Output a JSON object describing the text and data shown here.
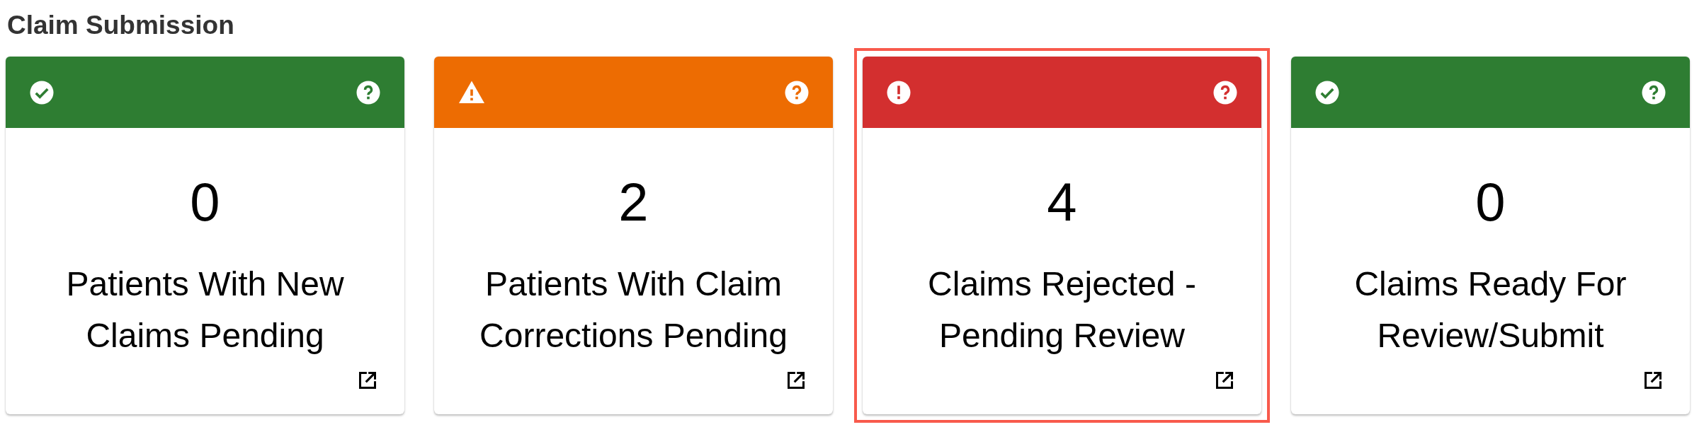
{
  "title": "Claim Submission",
  "cards": [
    {
      "kind": "success",
      "count": "0",
      "label": "Patients With New Claims Pending",
      "selected": false
    },
    {
      "kind": "warning",
      "count": "2",
      "label": "Patients With Claim Corrections Pending",
      "selected": false
    },
    {
      "kind": "error",
      "count": "4",
      "label": "Claims Rejected - Pending Review",
      "selected": true
    },
    {
      "kind": "success",
      "count": "0",
      "label": "Claims Ready For Review/Submit",
      "selected": false
    }
  ]
}
